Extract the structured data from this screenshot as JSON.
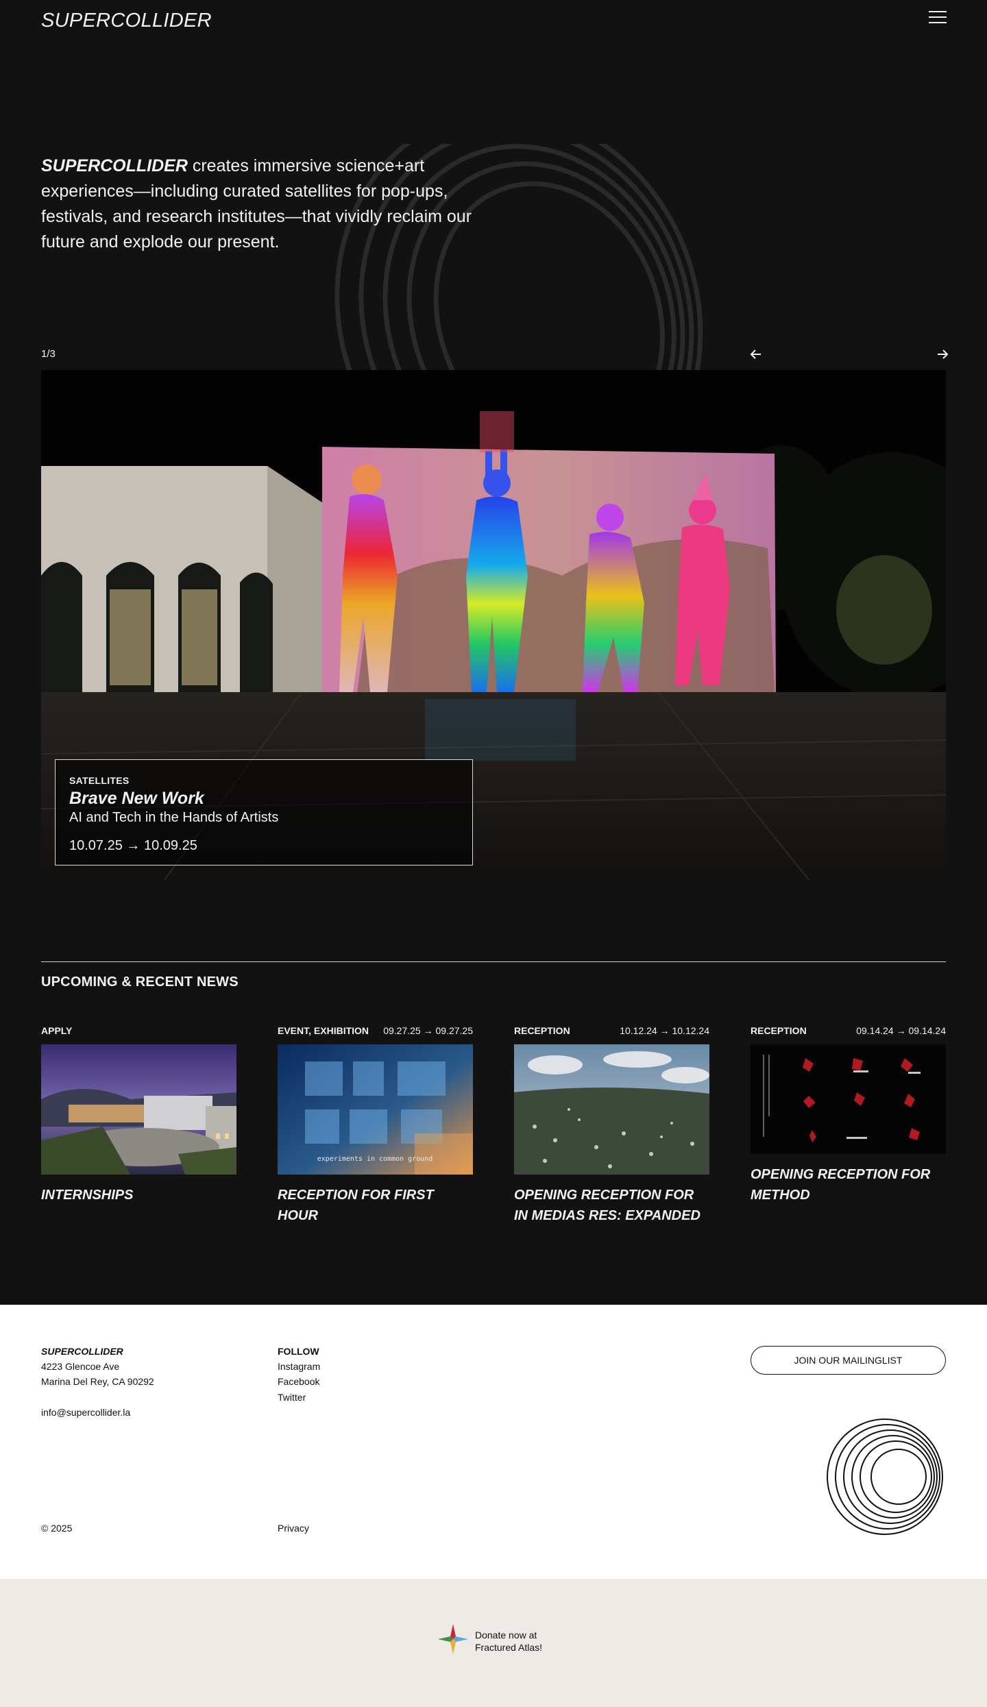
{
  "header": {
    "logo": "SUPERCOLLIDER",
    "menu_icon": "hamburger-icon"
  },
  "intro": {
    "brand": "SUPERCOLLIDER",
    "text": " creates immersive science+art experiences—including curated satellites for pop-ups, festivals, and research institutes—that vividly reclaim our future and explode our present."
  },
  "slider": {
    "counter": "1/3",
    "prev_icon": "arrow-left-icon",
    "next_icon": "arrow-right-icon",
    "caption": {
      "kicker": "SATELLITES",
      "title": "Brave New Work",
      "subtitle": "AI and Tech in the Hands of Artists",
      "dates": "10.07.25 → 10.09.25"
    }
  },
  "news": {
    "heading": "UPCOMING & RECENT NEWS",
    "items": [
      {
        "category": "APPLY",
        "dates": "",
        "title": "INTERNSHIPS"
      },
      {
        "category": "EVENT, EXHIBITION",
        "dates": "09.27.25 → 09.27.25",
        "title": "RECEPTION FOR FIRST HOUR"
      },
      {
        "category": "RECEPTION",
        "dates": "10.12.24 → 10.12.24",
        "title": "OPENING RECEPTION FOR IN MEDIAS RES: EXPANDED"
      },
      {
        "category": "RECEPTION",
        "dates": "09.14.24 → 09.14.24",
        "title": "OPENING RECEPTION FOR METHOD"
      }
    ],
    "first_hour_image_text": "experiments in common ground"
  },
  "footer": {
    "brand": "SUPERCOLLIDER",
    "address1": "4223 Glencoe Ave",
    "address2": "Marina Del Rey, CA 90292",
    "email": "info@supercollider.la",
    "copyright": "© 2025",
    "follow_heading": "FOLLOW",
    "links": [
      "Instagram",
      "Facebook",
      "Twitter"
    ],
    "privacy": "Privacy",
    "mailing_button": "JOIN OUR MAILINGLIST",
    "rings_icon": "concentric-rings-logo"
  },
  "donate": {
    "line1": "Donate now at",
    "line2": "Fractured Atlas!",
    "icon": "fractured-atlas-star-icon"
  },
  "colors": {
    "background": "#121212",
    "text": "#f2f2f2",
    "footer_bg": "#ffffff",
    "donate_bg": "#eeebe7"
  }
}
